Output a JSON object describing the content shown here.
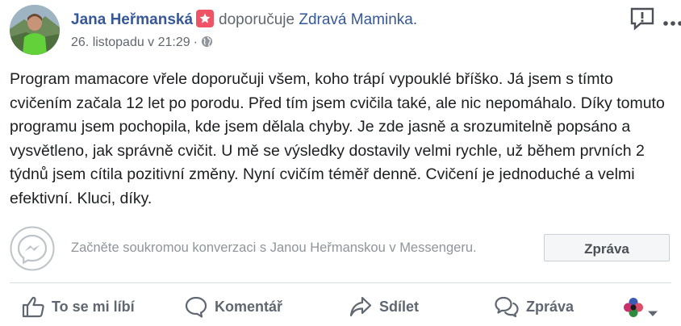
{
  "post": {
    "author": "Jana Heřmanská",
    "verb": "doporučuje",
    "page": "Zdravá Maminka.",
    "timestamp": "26. listopadu v 21:29",
    "separator": "·",
    "text": "Program mamacore vřele doporučuji všem, koho trápí vypouklé bříško. Já jsem s tímto cvičením začala 12 let po porodu. Před tím jsem cvičila také, ale nic nepomáhalo. Díky tomuto programu jsem pochopila, kde jsem dělala chyby. Je zde jasně a srozumitelně popsáno a vysvětleno, jak správně cvičit. U mě se výsledky dostavily velmi rychle, už během prvních 2 týdnů jsem cítila pozitivní změny. Nyní cvičím téměř denně. Cvičení je jednoduché a velmi efektivní. Kluci, díky."
  },
  "messenger": {
    "prompt": "Začněte soukromou konverzaci s Janou Heřmanskou v Messengeru.",
    "button": "Zpráva"
  },
  "actions": {
    "like": "To se mi líbí",
    "comment": "Komentář",
    "share": "Sdílet",
    "message": "Zpráva"
  },
  "icons": {
    "recommend": "star-badge-icon",
    "privacy": "globe-icon",
    "report": "report-icon",
    "more": "more-icon",
    "messenger": "messenger-icon",
    "like": "thumbs-up-icon",
    "comment": "comment-icon",
    "share": "share-icon",
    "message": "chat-bubbles-icon",
    "reaction": "reaction-flower-icon"
  },
  "colors": {
    "link": "#365899",
    "secondary": "#616770",
    "badge": "#ef5466",
    "divider": "#dadde1"
  }
}
